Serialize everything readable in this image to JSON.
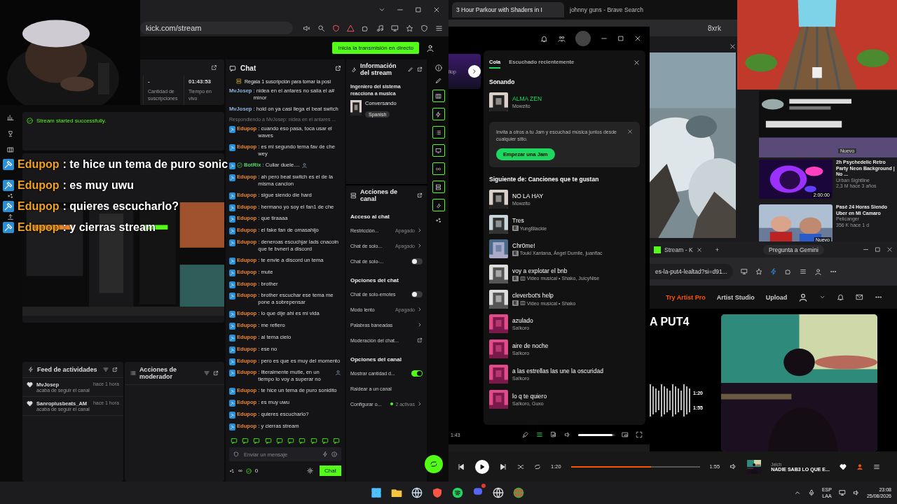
{
  "kick": {
    "url": "kick.com/stream",
    "go_live": "Inicia la transmisión en directo",
    "stats": [
      {
        "value": "-",
        "label": "Cantidad de suscripciones"
      },
      {
        "value": "01:43:53",
        "label": "Tiempo en vivo"
      }
    ],
    "notice": "Stream started successfully.",
    "overlay_chat": [
      {
        "user": "Edupop",
        "text": ": te hice un tema de puro sonic"
      },
      {
        "user": "Edupop",
        "text": ": es muy uwu"
      },
      {
        "user": "Edupop",
        "text": ": quieres escucharlo?"
      },
      {
        "user": "Edupop",
        "text": ": y cierras stream"
      }
    ],
    "activity_feed": {
      "title": "Feed de actividades",
      "items": [
        {
          "user": "MvJosep",
          "time": "hace 1 hora",
          "text": "acaba de seguir el canal"
        },
        {
          "user": "Sanroplusbeats_AM",
          "time": "hace 1 hora",
          "text": "acaba de seguir el canal"
        }
      ]
    },
    "mod_actions": {
      "title": "Acciones de moderador"
    },
    "chat": {
      "title": "Chat",
      "pinned": "Regala 1 suscripción para tomar la posi",
      "placeholder": "Enviar un mensaje",
      "infinity": "∞",
      "viewers": "0",
      "send": "Chat",
      "messages": [
        {
          "kind": "message",
          "user": "MvJosep",
          "color": "#8fb4e0",
          "badge": false,
          "verified": false,
          "emote": false,
          "text": ": nidea en el antares no salia el a# minor"
        },
        {
          "kind": "message",
          "user": "MvJosep",
          "color": "#8fb4e0",
          "badge": false,
          "verified": false,
          "emote": false,
          "text": ": hold on ya casi llega el beat switch"
        },
        {
          "kind": "reply",
          "text": "Respondiendo a MvJosep: nidea en el antares ..."
        },
        {
          "kind": "message",
          "user": "Edupop",
          "color": "#e8862f",
          "badge": true,
          "verified": false,
          "emote": false,
          "text": ": cuando eso pasa, toca usar el waves"
        },
        {
          "kind": "message",
          "user": "Edupop",
          "color": "#e8862f",
          "badge": true,
          "verified": false,
          "emote": false,
          "text": ": es mi segundo tema fav de che wey"
        },
        {
          "kind": "message",
          "user": "BotRix",
          "color": "#53d769",
          "badge": true,
          "verified": true,
          "emote": true,
          "text": ": Culiar duele...."
        },
        {
          "kind": "message",
          "user": "Edupop",
          "color": "#e8862f",
          "badge": true,
          "verified": false,
          "emote": false,
          "text": ": ah pero beat switch es el de la misma cancion"
        },
        {
          "kind": "message",
          "user": "Edupop",
          "color": "#e8862f",
          "badge": true,
          "verified": false,
          "emote": false,
          "text": ": sigue siendo die hard"
        },
        {
          "kind": "message",
          "user": "Edupop",
          "color": "#e8862f",
          "badge": true,
          "verified": false,
          "emote": false,
          "text": ": hermano yo soy el fan1 de che"
        },
        {
          "kind": "message",
          "user": "Edupop",
          "color": "#e8862f",
          "badge": true,
          "verified": false,
          "emote": false,
          "text": ": que tiraaaa"
        },
        {
          "kind": "message",
          "user": "Edupop",
          "color": "#e8862f",
          "badge": true,
          "verified": false,
          "emote": false,
          "text": ": el fake fan de omasahijo"
        },
        {
          "kind": "message",
          "user": "Edupop",
          "color": "#e8862f",
          "badge": true,
          "verified": false,
          "emote": false,
          "text": ": deneroas escuchjar lads cnacoin que te bvneri a discord"
        },
        {
          "kind": "message",
          "user": "Edupop",
          "color": "#e8862f",
          "badge": true,
          "verified": false,
          "emote": false,
          "text": ": te envie a discord un tema"
        },
        {
          "kind": "message",
          "user": "Edupop",
          "color": "#e8862f",
          "badge": true,
          "verified": false,
          "emote": false,
          "text": ": mute"
        },
        {
          "kind": "message",
          "user": "Edupop",
          "color": "#e8862f",
          "badge": true,
          "verified": false,
          "emote": false,
          "text": ": brother"
        },
        {
          "kind": "message",
          "user": "Edupop",
          "color": "#e8862f",
          "badge": true,
          "verified": false,
          "emote": false,
          "text": ": brother escuchar ese tema me pone a sobrepensar"
        },
        {
          "kind": "message",
          "user": "Edupop",
          "color": "#e8862f",
          "badge": true,
          "verified": false,
          "emote": false,
          "text": ": lo que dije ahi es mi vida"
        },
        {
          "kind": "message",
          "user": "Edupop",
          "color": "#e8862f",
          "badge": true,
          "verified": false,
          "emote": false,
          "text": ": me refiero"
        },
        {
          "kind": "message",
          "user": "Edupop",
          "color": "#e8862f",
          "badge": true,
          "verified": false,
          "emote": false,
          "text": ": al tema cielo"
        },
        {
          "kind": "message",
          "user": "Edupop",
          "color": "#e8862f",
          "badge": true,
          "verified": false,
          "emote": false,
          "text": ": ese no"
        },
        {
          "kind": "message",
          "user": "Edupop",
          "color": "#e8862f",
          "badge": true,
          "verified": false,
          "emote": false,
          "text": ": pero es que es muy del momento"
        },
        {
          "kind": "message",
          "user": "Edupop",
          "color": "#e8862f",
          "badge": true,
          "verified": false,
          "emote": true,
          "text": ": literalmente mutie, en un tiempo lo voy a superar no"
        },
        {
          "kind": "message",
          "user": "Edupop",
          "color": "#e8862f",
          "badge": true,
          "verified": false,
          "emote": false,
          "text": ": te hice un tema de puro sonidito"
        },
        {
          "kind": "message",
          "user": "Edupop",
          "color": "#e8862f",
          "badge": true,
          "verified": false,
          "emote": false,
          "text": ": es muy uwu"
        },
        {
          "kind": "message",
          "user": "Edupop",
          "color": "#e8862f",
          "badge": true,
          "verified": false,
          "emote": false,
          "text": ": quieres escucharlo?"
        },
        {
          "kind": "message",
          "user": "Edupop",
          "color": "#e8862f",
          "badge": true,
          "verified": false,
          "emote": false,
          "text": ": y cierras stream"
        }
      ]
    },
    "stream_info": {
      "title": "Información del stream",
      "stream_title": "Ingeniero del sistema reacciona a musica",
      "category": "Conversando",
      "tag": "Spanish"
    },
    "channel_actions": {
      "title": "Acciones de canal",
      "sections": [
        {
          "title": "Acceso al chat",
          "rows": [
            {
              "kind": "select",
              "label": "Restricción...",
              "value": "Apagado"
            },
            {
              "kind": "select",
              "label": "Chat de solo...",
              "value": "Apagado"
            },
            {
              "kind": "toggle",
              "label": "Chat de solo-...",
              "on": false
            }
          ]
        },
        {
          "title": "Opciones del chat",
          "rows": [
            {
              "kind": "toggle",
              "label": "Chat de solo-emotes",
              "on": false
            },
            {
              "kind": "select",
              "label": "Modo lento",
              "value": "Apagado"
            },
            {
              "kind": "nav",
              "label": "Palabras baneadas"
            },
            {
              "kind": "external",
              "label": "Moderación del chat..."
            }
          ]
        },
        {
          "title": "Opciones del canal",
          "rows": [
            {
              "kind": "toggle",
              "label": "Mostrar cantidad d...",
              "on": true
            },
            {
              "kind": "action",
              "label": "Raidear a un canal"
            },
            {
              "kind": "status",
              "label": "Configurar o...",
              "value": "2 activas"
            }
          ]
        }
      ]
    }
  },
  "brave": {
    "tabs": [
      {
        "title": "3 Hour Parkour with Shaders in I",
        "selected": true
      },
      {
        "title": "johnny guns - Brave Search",
        "selected": false
      }
    ],
    "url_fragment": "8xrk",
    "new_badge": "Nuevo",
    "sidebar": [
      {
        "title": "2h Psychedelic Retro Party Neon Background | No ...",
        "channel": "Urban Sightline",
        "meta": "2,3 M hace 3 años",
        "duration": "2:00:00"
      },
      {
        "title": "Pasé 24 Horas Siendo Uber en Mi Camaro",
        "channel": "Pelicanger",
        "meta": "356 K hace 1 d",
        "duration": "Nuevo"
      }
    ]
  },
  "spotify": {
    "side_fragment": "llop",
    "tabs": [
      {
        "label": "Cola",
        "selected": true
      },
      {
        "label": "Escuchado recientemente",
        "selected": false
      }
    ],
    "now_heading": "Sonando",
    "now": {
      "title": "ALMA ZEN",
      "artist": "Mowzito"
    },
    "jam": {
      "text": "Invita a otros a tu Jam y escuchad música juntos desde cualquier sitio.",
      "button": "Empezar una Jam"
    },
    "next_heading": "Siguiente de: Canciones que te gustan",
    "queue": [
      {
        "title": "NO LA HAY",
        "subtitle": "Mowzito",
        "video": false
      },
      {
        "title": "Tres",
        "badge": "E",
        "subtitle": "YungBlackie",
        "video": false
      },
      {
        "title": "Chr0me!",
        "badge": "E",
        "subtitle": "Touki Xantana, Ángel Dumile, juanflac",
        "video": false
      },
      {
        "title": "voy a explotar el bnb",
        "badge": "E",
        "subtitle": "Video musical • Shako, JuicyNise",
        "video": true
      },
      {
        "title": "cleverbot's help",
        "badge": "E",
        "subtitle": "Video musical • Shako",
        "video": true
      },
      {
        "title": "azulado",
        "subtitle": "Sa!koro",
        "video": false
      },
      {
        "title": "aire de noche",
        "subtitle": "Sa!koro",
        "video": false
      },
      {
        "title": "a las estrellas las une la oscuridad",
        "subtitle": "Sa!koro",
        "video": false
      },
      {
        "title": "lo q te quiero",
        "subtitle": "Sa!koro, Guxo",
        "video": false
      }
    ],
    "elapsed": "1:43",
    "volume": {
      "level": 0.95
    }
  },
  "chrome": {
    "tab": "Stream - K",
    "new_tab": "+",
    "gemini": "Pregunta a Gemini",
    "url": "es-la-put4-lealtad?si=d91...",
    "nav": [
      "Try Artist Pro",
      "Artist Studio",
      "Upload"
    ],
    "track_title": "A PUT4",
    "wave_times": [
      "1:20",
      "1:55"
    ]
  },
  "player": {
    "elapsed": "1:20",
    "duration": "1:55",
    "level": 0.62,
    "artist": "Jeich",
    "title": "NADIE SAB3 LO QUE E..."
  },
  "taskbar": {
    "lang": "ESP",
    "region": "LAA",
    "time": "23:08",
    "date": "25/08/2026"
  }
}
